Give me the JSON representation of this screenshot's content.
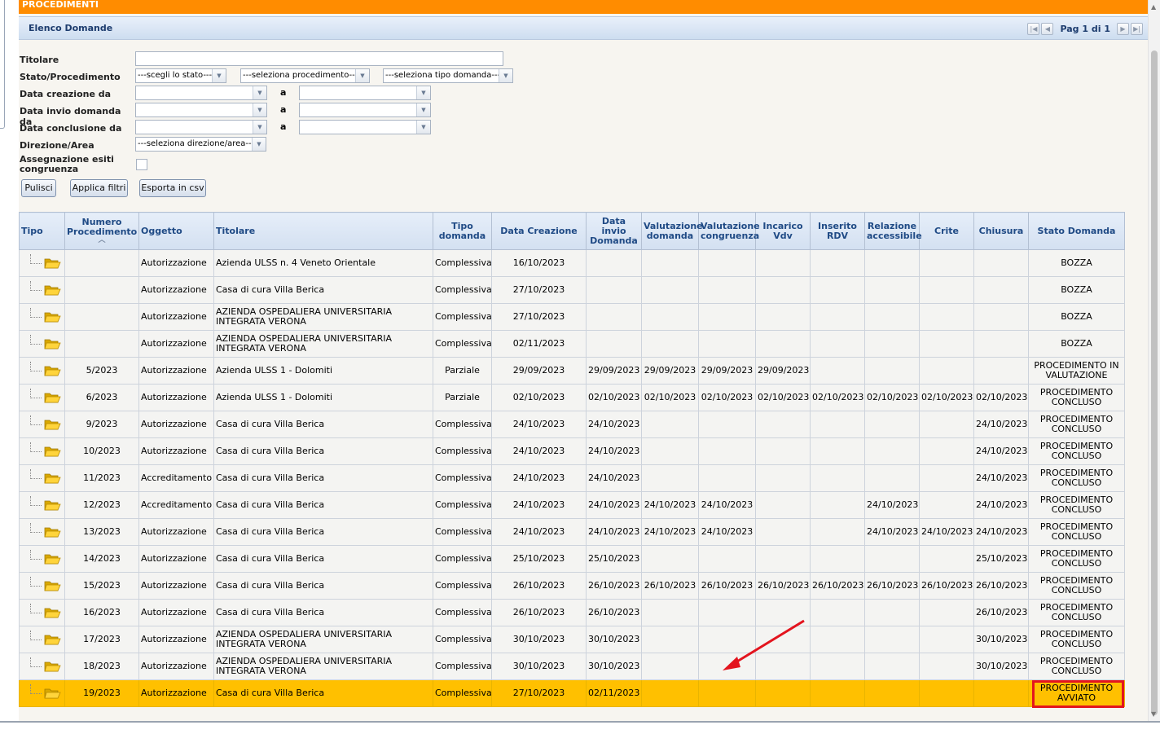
{
  "app_header": "PROCEDIMENTI",
  "panel_title": "Elenco Domande",
  "pager_label": "Pag 1 di 1",
  "filters": {
    "titolare_label": "Titolare",
    "stato_label": "Stato/Procedimento",
    "stato_select": "---scegli lo stato---",
    "procedimento_select": "---seleziona procedimento---",
    "tipo_domanda_select": "---seleziona tipo domanda---",
    "data_creazione_label": "Data creazione da",
    "data_invio_label": "Data invio domanda da",
    "data_conclusione_label": "Data conclusione da",
    "a_label": "a",
    "direzione_label": "Direzione/Area",
    "direzione_select": "---seleziona direzione/area---",
    "assegnazione_label": "Assegnazione esiti congruenza"
  },
  "buttons": {
    "pulisci": "Pulisci",
    "applica": "Applica filtri",
    "esporta": "Esporta in csv"
  },
  "table": {
    "headers": [
      "Tipo",
      "Numero Procedimento",
      "Oggetto",
      "Titolare",
      "Tipo domanda",
      "Data Creazione",
      "Data invio Domanda",
      "Valutazione domanda",
      "Valutazione congruenza",
      "Incarico Vdv",
      "Inserito RDV",
      "Relazione accessibile",
      "Crite",
      "Chiusura",
      "Stato Domanda"
    ],
    "rows": [
      [
        "",
        "Autorizzazione",
        "Azienda ULSS n. 4 Veneto Orientale",
        "Complessiva",
        "16/10/2023",
        "",
        "",
        "",
        "",
        "",
        "",
        "",
        "",
        "BOZZA"
      ],
      [
        "",
        "Autorizzazione",
        "Casa di cura Villa Berica",
        "Complessiva",
        "27/10/2023",
        "",
        "",
        "",
        "",
        "",
        "",
        "",
        "",
        "BOZZA"
      ],
      [
        "",
        "Autorizzazione",
        "AZIENDA OSPEDALIERA UNIVERSITARIA INTEGRATA VERONA",
        "Complessiva",
        "27/10/2023",
        "",
        "",
        "",
        "",
        "",
        "",
        "",
        "",
        "BOZZA"
      ],
      [
        "",
        "Autorizzazione",
        "AZIENDA OSPEDALIERA UNIVERSITARIA INTEGRATA VERONA",
        "Complessiva",
        "02/11/2023",
        "",
        "",
        "",
        "",
        "",
        "",
        "",
        "",
        "BOZZA"
      ],
      [
        "5/2023",
        "Autorizzazione",
        "Azienda ULSS 1 - Dolomiti",
        "Parziale",
        "29/09/2023",
        "29/09/2023",
        "29/09/2023",
        "29/09/2023",
        "29/09/2023",
        "",
        "",
        "",
        "",
        "PROCEDIMENTO IN VALUTAZIONE"
      ],
      [
        "6/2023",
        "Autorizzazione",
        "Azienda ULSS 1 - Dolomiti",
        "Parziale",
        "02/10/2023",
        "02/10/2023",
        "02/10/2023",
        "02/10/2023",
        "02/10/2023",
        "02/10/2023",
        "02/10/2023",
        "02/10/2023",
        "02/10/2023",
        "PROCEDIMENTO CONCLUSO"
      ],
      [
        "9/2023",
        "Autorizzazione",
        "Casa di cura Villa Berica",
        "Complessiva",
        "24/10/2023",
        "24/10/2023",
        "",
        "",
        "",
        "",
        "",
        "",
        "24/10/2023",
        "PROCEDIMENTO CONCLUSO"
      ],
      [
        "10/2023",
        "Autorizzazione",
        "Casa di cura Villa Berica",
        "Complessiva",
        "24/10/2023",
        "24/10/2023",
        "",
        "",
        "",
        "",
        "",
        "",
        "24/10/2023",
        "PROCEDIMENTO CONCLUSO"
      ],
      [
        "11/2023",
        "Accreditamento",
        "Casa di cura Villa Berica",
        "Complessiva",
        "24/10/2023",
        "24/10/2023",
        "",
        "",
        "",
        "",
        "",
        "",
        "24/10/2023",
        "PROCEDIMENTO CONCLUSO"
      ],
      [
        "12/2023",
        "Accreditamento",
        "Casa di cura Villa Berica",
        "Complessiva",
        "24/10/2023",
        "24/10/2023",
        "24/10/2023",
        "24/10/2023",
        "",
        "",
        "24/10/2023",
        "",
        "24/10/2023",
        "PROCEDIMENTO CONCLUSO"
      ],
      [
        "13/2023",
        "Autorizzazione",
        "Casa di cura Villa Berica",
        "Complessiva",
        "24/10/2023",
        "24/10/2023",
        "24/10/2023",
        "24/10/2023",
        "",
        "",
        "24/10/2023",
        "24/10/2023",
        "24/10/2023",
        "PROCEDIMENTO CONCLUSO"
      ],
      [
        "14/2023",
        "Autorizzazione",
        "Casa di cura Villa Berica",
        "Complessiva",
        "25/10/2023",
        "25/10/2023",
        "",
        "",
        "",
        "",
        "",
        "",
        "25/10/2023",
        "PROCEDIMENTO CONCLUSO"
      ],
      [
        "15/2023",
        "Autorizzazione",
        "Casa di cura Villa Berica",
        "Complessiva",
        "26/10/2023",
        "26/10/2023",
        "26/10/2023",
        "26/10/2023",
        "26/10/2023",
        "26/10/2023",
        "26/10/2023",
        "26/10/2023",
        "26/10/2023",
        "PROCEDIMENTO CONCLUSO"
      ],
      [
        "16/2023",
        "Autorizzazione",
        "Casa di cura Villa Berica",
        "Complessiva",
        "26/10/2023",
        "26/10/2023",
        "",
        "",
        "",
        "",
        "",
        "",
        "26/10/2023",
        "PROCEDIMENTO CONCLUSO"
      ],
      [
        "17/2023",
        "Autorizzazione",
        "AZIENDA OSPEDALIERA UNIVERSITARIA INTEGRATA VERONA",
        "Complessiva",
        "30/10/2023",
        "30/10/2023",
        "",
        "",
        "",
        "",
        "",
        "",
        "30/10/2023",
        "PROCEDIMENTO CONCLUSO"
      ],
      [
        "18/2023",
        "Autorizzazione",
        "AZIENDA OSPEDALIERA UNIVERSITARIA INTEGRATA VERONA",
        "Complessiva",
        "30/10/2023",
        "30/10/2023",
        "",
        "",
        "",
        "",
        "",
        "",
        "30/10/2023",
        "PROCEDIMENTO CONCLUSO"
      ],
      [
        "19/2023",
        "Autorizzazione",
        "Casa di cura Villa Berica",
        "Complessiva",
        "27/10/2023",
        "02/11/2023",
        "",
        "",
        "",
        "",
        "",
        "",
        "",
        "PROCEDIMENTO AVVIATO"
      ]
    ],
    "highlighted_row": 16
  },
  "colors": {
    "accent_orange": "#ff8c00",
    "highlight_row": "#ffc000",
    "annotation_red": "#e3141e"
  }
}
